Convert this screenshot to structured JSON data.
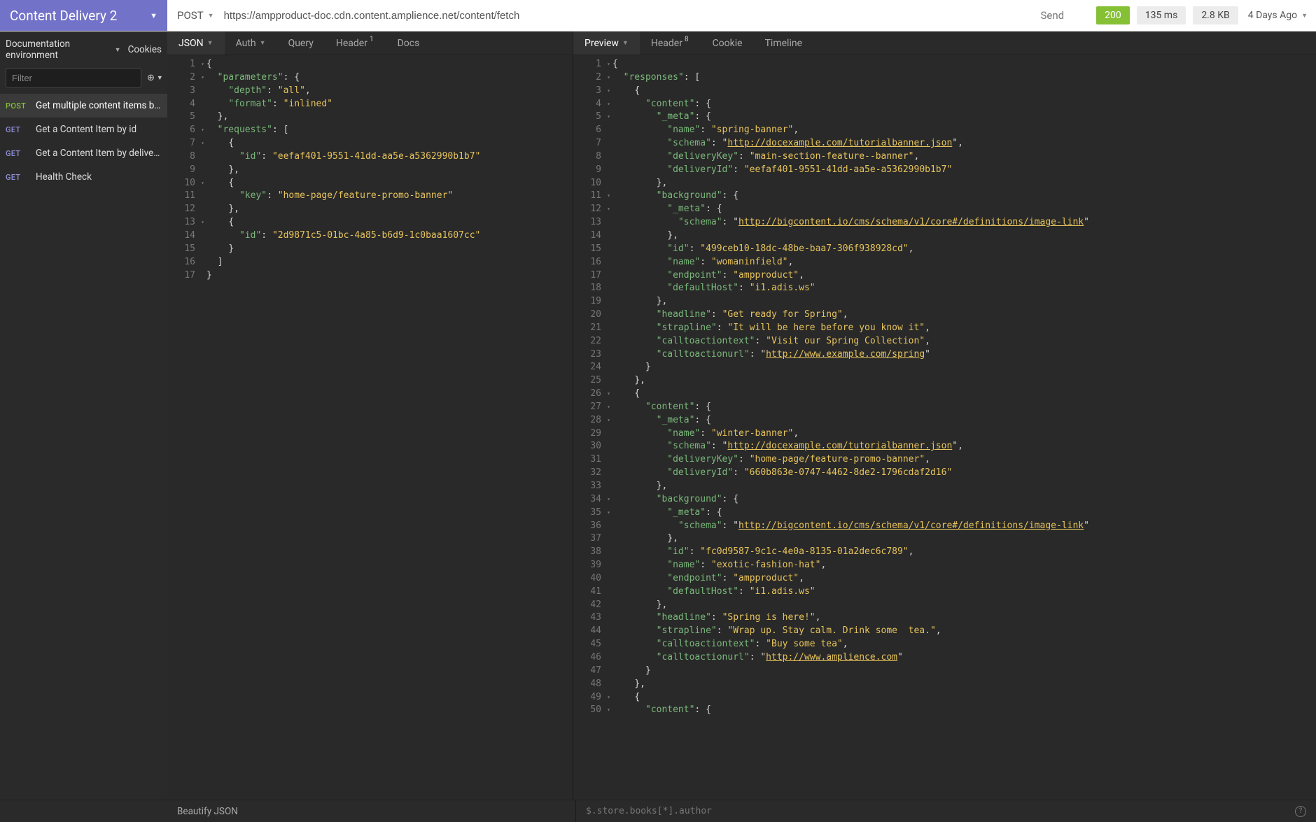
{
  "workspace": {
    "name": "Content Delivery 2"
  },
  "request": {
    "method": "POST",
    "url": "https://ampproduct-doc.cdn.content.amplience.net/content/fetch",
    "send_label": "Send"
  },
  "response_meta": {
    "status": "200",
    "time": "135 ms",
    "size": "2.8 KB",
    "timestamp": "4 Days Ago"
  },
  "sidebar": {
    "env_label": "Documentation environment",
    "cookies_label": "Cookies",
    "filter_placeholder": "Filter",
    "items": [
      {
        "method": "POST",
        "method_class": "post",
        "name": "Get multiple content items by id ...",
        "active": true
      },
      {
        "method": "GET",
        "method_class": "get",
        "name": "Get a Content Item by id",
        "active": false
      },
      {
        "method": "GET",
        "method_class": "get",
        "name": "Get a Content Item by delivery key",
        "active": false
      },
      {
        "method": "GET",
        "method_class": "get",
        "name": "Health Check",
        "active": false
      }
    ]
  },
  "left_tabs": {
    "json": "JSON",
    "auth": "Auth",
    "query": "Query",
    "header": "Header",
    "header_badge": "1",
    "docs": "Docs"
  },
  "right_tabs": {
    "preview": "Preview",
    "header": "Header",
    "header_badge": "8",
    "cookie": "Cookie",
    "timeline": "Timeline"
  },
  "footer": {
    "beautify": "Beautify JSON",
    "jsonpath": "$.store.books[*].author"
  },
  "request_body": [
    {
      "n": 1,
      "indent": 0,
      "fold": true,
      "tokens": [
        {
          "t": "punc",
          "v": "{"
        }
      ]
    },
    {
      "n": 2,
      "indent": 1,
      "fold": true,
      "tokens": [
        {
          "t": "key",
          "v": "\"parameters\""
        },
        {
          "t": "punc",
          "v": ": {"
        }
      ]
    },
    {
      "n": 3,
      "indent": 2,
      "fold": false,
      "tokens": [
        {
          "t": "key",
          "v": "\"depth\""
        },
        {
          "t": "punc",
          "v": ": "
        },
        {
          "t": "str",
          "v": "\"all\""
        },
        {
          "t": "punc",
          "v": ","
        }
      ]
    },
    {
      "n": 4,
      "indent": 2,
      "fold": false,
      "tokens": [
        {
          "t": "key",
          "v": "\"format\""
        },
        {
          "t": "punc",
          "v": ": "
        },
        {
          "t": "str",
          "v": "\"inlined\""
        }
      ]
    },
    {
      "n": 5,
      "indent": 1,
      "fold": false,
      "tokens": [
        {
          "t": "punc",
          "v": "},"
        }
      ]
    },
    {
      "n": 6,
      "indent": 1,
      "fold": true,
      "tokens": [
        {
          "t": "key",
          "v": "\"requests\""
        },
        {
          "t": "punc",
          "v": ": ["
        }
      ]
    },
    {
      "n": 7,
      "indent": 2,
      "fold": true,
      "tokens": [
        {
          "t": "punc",
          "v": "{"
        }
      ]
    },
    {
      "n": 8,
      "indent": 3,
      "fold": false,
      "tokens": [
        {
          "t": "key",
          "v": "\"id\""
        },
        {
          "t": "punc",
          "v": ": "
        },
        {
          "t": "str",
          "v": "\"eefaf401-9551-41dd-aa5e-a5362990b1b7\""
        }
      ]
    },
    {
      "n": 9,
      "indent": 2,
      "fold": false,
      "tokens": [
        {
          "t": "punc",
          "v": "},"
        }
      ]
    },
    {
      "n": 10,
      "indent": 2,
      "fold": true,
      "tokens": [
        {
          "t": "punc",
          "v": "{"
        }
      ]
    },
    {
      "n": 11,
      "indent": 3,
      "fold": false,
      "tokens": [
        {
          "t": "key",
          "v": "\"key\""
        },
        {
          "t": "punc",
          "v": ": "
        },
        {
          "t": "str",
          "v": "\"home-page/feature-promo-banner\""
        }
      ]
    },
    {
      "n": 12,
      "indent": 2,
      "fold": false,
      "tokens": [
        {
          "t": "punc",
          "v": "},"
        }
      ]
    },
    {
      "n": 13,
      "indent": 2,
      "fold": true,
      "tokens": [
        {
          "t": "punc",
          "v": "{"
        }
      ]
    },
    {
      "n": 14,
      "indent": 3,
      "fold": false,
      "tokens": [
        {
          "t": "key",
          "v": "\"id\""
        },
        {
          "t": "punc",
          "v": ": "
        },
        {
          "t": "str",
          "v": "\"2d9871c5-01bc-4a85-b6d9-1c0baa1607cc\""
        }
      ]
    },
    {
      "n": 15,
      "indent": 2,
      "fold": false,
      "tokens": [
        {
          "t": "punc",
          "v": "}"
        }
      ]
    },
    {
      "n": 16,
      "indent": 1,
      "fold": false,
      "tokens": [
        {
          "t": "punc",
          "v": "]"
        }
      ]
    },
    {
      "n": 17,
      "indent": 0,
      "fold": false,
      "tokens": [
        {
          "t": "punc",
          "v": "}"
        }
      ]
    }
  ],
  "response_body": [
    {
      "n": 1,
      "indent": 0,
      "fold": true,
      "tokens": [
        {
          "t": "punc",
          "v": "{"
        }
      ]
    },
    {
      "n": 2,
      "indent": 1,
      "fold": true,
      "tokens": [
        {
          "t": "key",
          "v": "\"responses\""
        },
        {
          "t": "punc",
          "v": ": ["
        }
      ]
    },
    {
      "n": 3,
      "indent": 2,
      "fold": true,
      "tokens": [
        {
          "t": "punc",
          "v": "{"
        }
      ]
    },
    {
      "n": 4,
      "indent": 3,
      "fold": true,
      "tokens": [
        {
          "t": "key",
          "v": "\"content\""
        },
        {
          "t": "punc",
          "v": ": {"
        }
      ]
    },
    {
      "n": 5,
      "indent": 4,
      "fold": true,
      "tokens": [
        {
          "t": "key",
          "v": "\"_meta\""
        },
        {
          "t": "punc",
          "v": ": {"
        }
      ]
    },
    {
      "n": 6,
      "indent": 5,
      "fold": false,
      "tokens": [
        {
          "t": "key",
          "v": "\"name\""
        },
        {
          "t": "punc",
          "v": ": "
        },
        {
          "t": "str",
          "v": "\"spring-banner\""
        },
        {
          "t": "punc",
          "v": ","
        }
      ]
    },
    {
      "n": 7,
      "indent": 5,
      "fold": false,
      "tokens": [
        {
          "t": "key",
          "v": "\"schema\""
        },
        {
          "t": "punc",
          "v": ": \""
        },
        {
          "t": "url",
          "v": "http://docexample.com/tutorialbanner.json"
        },
        {
          "t": "punc",
          "v": "\","
        }
      ]
    },
    {
      "n": 8,
      "indent": 5,
      "fold": false,
      "tokens": [
        {
          "t": "key",
          "v": "\"deliveryKey\""
        },
        {
          "t": "punc",
          "v": ": "
        },
        {
          "t": "str",
          "v": "\"main-section-feature--banner\""
        },
        {
          "t": "punc",
          "v": ","
        }
      ]
    },
    {
      "n": 9,
      "indent": 5,
      "fold": false,
      "tokens": [
        {
          "t": "key",
          "v": "\"deliveryId\""
        },
        {
          "t": "punc",
          "v": ": "
        },
        {
          "t": "str",
          "v": "\"eefaf401-9551-41dd-aa5e-a5362990b1b7\""
        }
      ]
    },
    {
      "n": 10,
      "indent": 4,
      "fold": false,
      "tokens": [
        {
          "t": "punc",
          "v": "},"
        }
      ]
    },
    {
      "n": 11,
      "indent": 4,
      "fold": true,
      "tokens": [
        {
          "t": "key",
          "v": "\"background\""
        },
        {
          "t": "punc",
          "v": ": {"
        }
      ]
    },
    {
      "n": 12,
      "indent": 5,
      "fold": true,
      "tokens": [
        {
          "t": "key",
          "v": "\"_meta\""
        },
        {
          "t": "punc",
          "v": ": {"
        }
      ]
    },
    {
      "n": 13,
      "indent": 6,
      "fold": false,
      "wrap": true,
      "tokens": [
        {
          "t": "key",
          "v": "\"schema\""
        },
        {
          "t": "punc",
          "v": ": \""
        },
        {
          "t": "url",
          "v": "http://bigcontent.io/cms/schema/v1/core#/definitions/image-link"
        },
        {
          "t": "punc",
          "v": "\""
        }
      ]
    },
    {
      "n": 14,
      "indent": 5,
      "fold": false,
      "tokens": [
        {
          "t": "punc",
          "v": "},"
        }
      ]
    },
    {
      "n": 15,
      "indent": 5,
      "fold": false,
      "tokens": [
        {
          "t": "key",
          "v": "\"id\""
        },
        {
          "t": "punc",
          "v": ": "
        },
        {
          "t": "str",
          "v": "\"499ceb10-18dc-48be-baa7-306f938928cd\""
        },
        {
          "t": "punc",
          "v": ","
        }
      ]
    },
    {
      "n": 16,
      "indent": 5,
      "fold": false,
      "tokens": [
        {
          "t": "key",
          "v": "\"name\""
        },
        {
          "t": "punc",
          "v": ": "
        },
        {
          "t": "str",
          "v": "\"womaninfield\""
        },
        {
          "t": "punc",
          "v": ","
        }
      ]
    },
    {
      "n": 17,
      "indent": 5,
      "fold": false,
      "tokens": [
        {
          "t": "key",
          "v": "\"endpoint\""
        },
        {
          "t": "punc",
          "v": ": "
        },
        {
          "t": "str",
          "v": "\"ampproduct\""
        },
        {
          "t": "punc",
          "v": ","
        }
      ]
    },
    {
      "n": 18,
      "indent": 5,
      "fold": false,
      "tokens": [
        {
          "t": "key",
          "v": "\"defaultHost\""
        },
        {
          "t": "punc",
          "v": ": "
        },
        {
          "t": "str",
          "v": "\"i1.adis.ws\""
        }
      ]
    },
    {
      "n": 19,
      "indent": 4,
      "fold": false,
      "tokens": [
        {
          "t": "punc",
          "v": "},"
        }
      ]
    },
    {
      "n": 20,
      "indent": 4,
      "fold": false,
      "tokens": [
        {
          "t": "key",
          "v": "\"headline\""
        },
        {
          "t": "punc",
          "v": ": "
        },
        {
          "t": "str",
          "v": "\"Get ready for Spring\""
        },
        {
          "t": "punc",
          "v": ","
        }
      ]
    },
    {
      "n": 21,
      "indent": 4,
      "fold": false,
      "tokens": [
        {
          "t": "key",
          "v": "\"strapline\""
        },
        {
          "t": "punc",
          "v": ": "
        },
        {
          "t": "str",
          "v": "\"It will be here before you know it\""
        },
        {
          "t": "punc",
          "v": ","
        }
      ]
    },
    {
      "n": 22,
      "indent": 4,
      "fold": false,
      "tokens": [
        {
          "t": "key",
          "v": "\"calltoactiontext\""
        },
        {
          "t": "punc",
          "v": ": "
        },
        {
          "t": "str",
          "v": "\"Visit our Spring Collection\""
        },
        {
          "t": "punc",
          "v": ","
        }
      ]
    },
    {
      "n": 23,
      "indent": 4,
      "fold": false,
      "tokens": [
        {
          "t": "key",
          "v": "\"calltoactionurl\""
        },
        {
          "t": "punc",
          "v": ": \""
        },
        {
          "t": "url",
          "v": "http://www.example.com/spring"
        },
        {
          "t": "punc",
          "v": "\""
        }
      ]
    },
    {
      "n": 24,
      "indent": 3,
      "fold": false,
      "tokens": [
        {
          "t": "punc",
          "v": "}"
        }
      ]
    },
    {
      "n": 25,
      "indent": 2,
      "fold": false,
      "tokens": [
        {
          "t": "punc",
          "v": "},"
        }
      ]
    },
    {
      "n": 26,
      "indent": 2,
      "fold": true,
      "tokens": [
        {
          "t": "punc",
          "v": "{"
        }
      ]
    },
    {
      "n": 27,
      "indent": 3,
      "fold": true,
      "tokens": [
        {
          "t": "key",
          "v": "\"content\""
        },
        {
          "t": "punc",
          "v": ": {"
        }
      ]
    },
    {
      "n": 28,
      "indent": 4,
      "fold": true,
      "tokens": [
        {
          "t": "key",
          "v": "\"_meta\""
        },
        {
          "t": "punc",
          "v": ": {"
        }
      ]
    },
    {
      "n": 29,
      "indent": 5,
      "fold": false,
      "tokens": [
        {
          "t": "key",
          "v": "\"name\""
        },
        {
          "t": "punc",
          "v": ": "
        },
        {
          "t": "str",
          "v": "\"winter-banner\""
        },
        {
          "t": "punc",
          "v": ","
        }
      ]
    },
    {
      "n": 30,
      "indent": 5,
      "fold": false,
      "tokens": [
        {
          "t": "key",
          "v": "\"schema\""
        },
        {
          "t": "punc",
          "v": ": \""
        },
        {
          "t": "url",
          "v": "http://docexample.com/tutorialbanner.json"
        },
        {
          "t": "punc",
          "v": "\","
        }
      ]
    },
    {
      "n": 31,
      "indent": 5,
      "fold": false,
      "tokens": [
        {
          "t": "key",
          "v": "\"deliveryKey\""
        },
        {
          "t": "punc",
          "v": ": "
        },
        {
          "t": "str",
          "v": "\"home-page/feature-promo-banner\""
        },
        {
          "t": "punc",
          "v": ","
        }
      ]
    },
    {
      "n": 32,
      "indent": 5,
      "fold": false,
      "tokens": [
        {
          "t": "key",
          "v": "\"deliveryId\""
        },
        {
          "t": "punc",
          "v": ": "
        },
        {
          "t": "str",
          "v": "\"660b863e-0747-4462-8de2-1796cdaf2d16\""
        }
      ]
    },
    {
      "n": 33,
      "indent": 4,
      "fold": false,
      "tokens": [
        {
          "t": "punc",
          "v": "},"
        }
      ]
    },
    {
      "n": 34,
      "indent": 4,
      "fold": true,
      "tokens": [
        {
          "t": "key",
          "v": "\"background\""
        },
        {
          "t": "punc",
          "v": ": {"
        }
      ]
    },
    {
      "n": 35,
      "indent": 5,
      "fold": true,
      "tokens": [
        {
          "t": "key",
          "v": "\"_meta\""
        },
        {
          "t": "punc",
          "v": ": {"
        }
      ]
    },
    {
      "n": 36,
      "indent": 6,
      "fold": false,
      "wrap": true,
      "tokens": [
        {
          "t": "key",
          "v": "\"schema\""
        },
        {
          "t": "punc",
          "v": ": \""
        },
        {
          "t": "url",
          "v": "http://bigcontent.io/cms/schema/v1/core#/definitions/image-link"
        },
        {
          "t": "punc",
          "v": "\""
        }
      ]
    },
    {
      "n": 37,
      "indent": 5,
      "fold": false,
      "tokens": [
        {
          "t": "punc",
          "v": "},"
        }
      ]
    },
    {
      "n": 38,
      "indent": 5,
      "fold": false,
      "tokens": [
        {
          "t": "key",
          "v": "\"id\""
        },
        {
          "t": "punc",
          "v": ": "
        },
        {
          "t": "str",
          "v": "\"fc0d9587-9c1c-4e0a-8135-01a2dec6c789\""
        },
        {
          "t": "punc",
          "v": ","
        }
      ]
    },
    {
      "n": 39,
      "indent": 5,
      "fold": false,
      "tokens": [
        {
          "t": "key",
          "v": "\"name\""
        },
        {
          "t": "punc",
          "v": ": "
        },
        {
          "t": "str",
          "v": "\"exotic-fashion-hat\""
        },
        {
          "t": "punc",
          "v": ","
        }
      ]
    },
    {
      "n": 40,
      "indent": 5,
      "fold": false,
      "tokens": [
        {
          "t": "key",
          "v": "\"endpoint\""
        },
        {
          "t": "punc",
          "v": ": "
        },
        {
          "t": "str",
          "v": "\"ampproduct\""
        },
        {
          "t": "punc",
          "v": ","
        }
      ]
    },
    {
      "n": 41,
      "indent": 5,
      "fold": false,
      "tokens": [
        {
          "t": "key",
          "v": "\"defaultHost\""
        },
        {
          "t": "punc",
          "v": ": "
        },
        {
          "t": "str",
          "v": "\"i1.adis.ws\""
        }
      ]
    },
    {
      "n": 42,
      "indent": 4,
      "fold": false,
      "tokens": [
        {
          "t": "punc",
          "v": "},"
        }
      ]
    },
    {
      "n": 43,
      "indent": 4,
      "fold": false,
      "tokens": [
        {
          "t": "key",
          "v": "\"headline\""
        },
        {
          "t": "punc",
          "v": ": "
        },
        {
          "t": "str",
          "v": "\"Spring is here!\""
        },
        {
          "t": "punc",
          "v": ","
        }
      ]
    },
    {
      "n": 44,
      "indent": 4,
      "fold": false,
      "tokens": [
        {
          "t": "key",
          "v": "\"strapline\""
        },
        {
          "t": "punc",
          "v": ": "
        },
        {
          "t": "str",
          "v": "\"Wrap up. Stay calm. Drink some  tea.\""
        },
        {
          "t": "punc",
          "v": ","
        }
      ]
    },
    {
      "n": 45,
      "indent": 4,
      "fold": false,
      "tokens": [
        {
          "t": "key",
          "v": "\"calltoactiontext\""
        },
        {
          "t": "punc",
          "v": ": "
        },
        {
          "t": "str",
          "v": "\"Buy some tea\""
        },
        {
          "t": "punc",
          "v": ","
        }
      ]
    },
    {
      "n": 46,
      "indent": 4,
      "fold": false,
      "tokens": [
        {
          "t": "key",
          "v": "\"calltoactionurl\""
        },
        {
          "t": "punc",
          "v": ": \""
        },
        {
          "t": "url",
          "v": "http://www.amplience.com"
        },
        {
          "t": "punc",
          "v": "\""
        }
      ]
    },
    {
      "n": 47,
      "indent": 3,
      "fold": false,
      "tokens": [
        {
          "t": "punc",
          "v": "}"
        }
      ]
    },
    {
      "n": 48,
      "indent": 2,
      "fold": false,
      "tokens": [
        {
          "t": "punc",
          "v": "},"
        }
      ]
    },
    {
      "n": 49,
      "indent": 2,
      "fold": true,
      "tokens": [
        {
          "t": "punc",
          "v": "{"
        }
      ]
    },
    {
      "n": 50,
      "indent": 3,
      "fold": true,
      "tokens": [
        {
          "t": "key",
          "v": "\"content\""
        },
        {
          "t": "punc",
          "v": ": {"
        }
      ]
    }
  ]
}
